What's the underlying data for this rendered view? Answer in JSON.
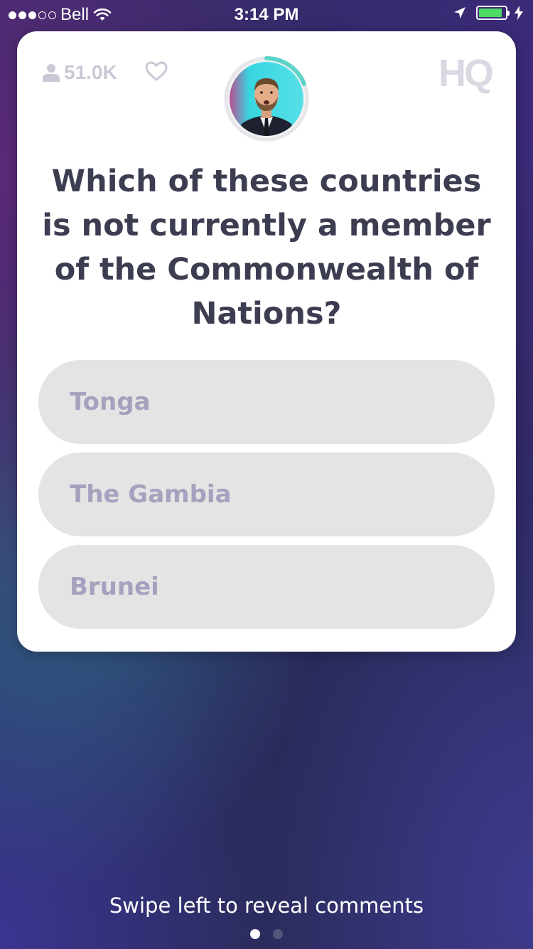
{
  "status_bar": {
    "carrier": "Bell",
    "time": "3:14 PM",
    "signal_full": 3,
    "signal_total": 5,
    "battery_level": 0.9,
    "battery_color": "#4cd964"
  },
  "card": {
    "viewer_count": "51.0K",
    "logo": "HQ",
    "question": "Which of these countries is not currently a member of the Commonwealth of Nations?",
    "answers": [
      "Tonga",
      "The Gambia",
      "Brunei"
    ],
    "timer_accent": "#5fd3c8"
  },
  "footer": {
    "swipe_hint": "Swipe left to reveal comments",
    "page_index": 1,
    "page_count": 2
  },
  "icons": {
    "wifi": "wifi-icon",
    "location": "location-arrow-icon",
    "charging": "charging-bolt-icon",
    "viewers": "person-icon",
    "like": "heart-icon"
  }
}
